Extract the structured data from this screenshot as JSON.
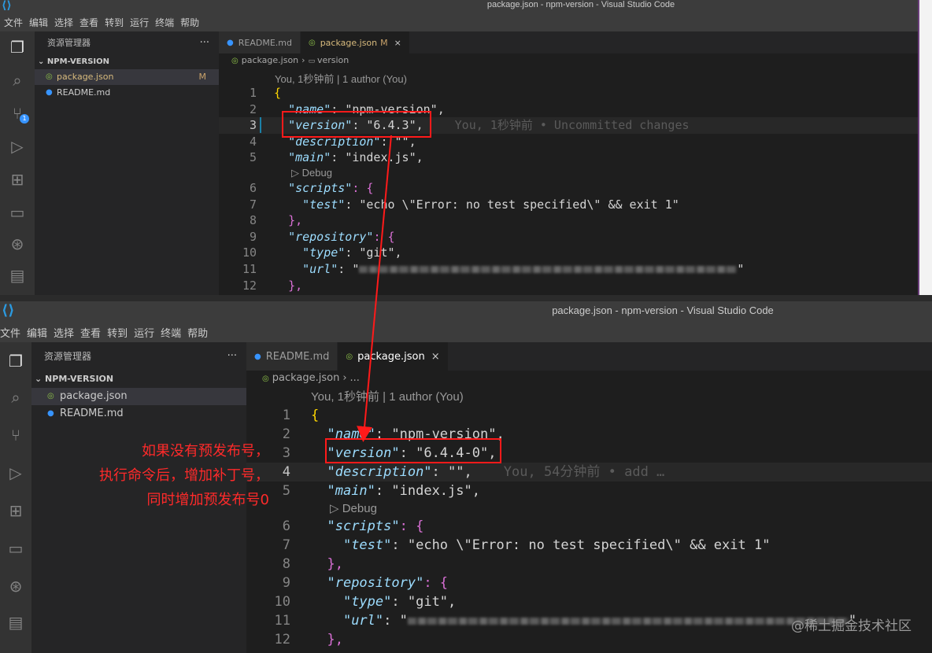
{
  "top": {
    "title": "package.json - npm-version - Visual Studio Code",
    "menu": [
      "文件",
      "编辑",
      "选择",
      "查看",
      "转到",
      "运行",
      "终端",
      "帮助"
    ],
    "sidebar": {
      "header": "资源管理器",
      "more": "···",
      "section": "NPM-VERSION",
      "files": [
        {
          "name": "package.json",
          "status": "M"
        },
        {
          "name": "README.md",
          "status": ""
        }
      ]
    },
    "tabs": [
      {
        "label": "README.md",
        "icon": "info-icon",
        "active": false
      },
      {
        "label": "package.json",
        "icon": "json-icon",
        "status": "M",
        "active": true
      }
    ],
    "breadcrumb": [
      "package.json",
      "version"
    ],
    "codelens": "You, 1秒钟前 | 1 author (You)",
    "debug": "Debug",
    "blame": "You, 1秒钟前 • Uncommitted changes",
    "scm_badge": "1",
    "lines": [
      {
        "n": "1",
        "text": "{"
      },
      {
        "n": "2",
        "key": "\"name\"",
        "value": "\"npm-version\"",
        "end": ","
      },
      {
        "n": "3",
        "key": "\"version\"",
        "value": "\"6.4.3\"",
        "end": ","
      },
      {
        "n": "4",
        "key": "\"description\"",
        "value": "\"\"",
        "end": ","
      },
      {
        "n": "5",
        "key": "\"main\"",
        "value": "\"index.js\"",
        "end": ","
      },
      {
        "n": "6",
        "key": "\"scripts\"",
        "end": ": {"
      },
      {
        "n": "7",
        "key": "\"test\"",
        "value": "\"echo \\\"Error: no test specified\\\" && exit 1\""
      },
      {
        "n": "8",
        "text": "},"
      },
      {
        "n": "9",
        "key": "\"repository\"",
        "end": ": {"
      },
      {
        "n": "10",
        "key": "\"type\"",
        "value": "\"git\"",
        "end": ","
      },
      {
        "n": "11",
        "key": "\"url\"",
        "value": "\""
      },
      {
        "n": "12",
        "text": "},"
      }
    ]
  },
  "bottom": {
    "title": "package.json - npm-version - Visual Studio Code",
    "menu": [
      "文件",
      "编辑",
      "选择",
      "查看",
      "转到",
      "运行",
      "终端",
      "帮助"
    ],
    "sidebar": {
      "header": "资源管理器",
      "more": "···",
      "section": "NPM-VERSION",
      "files": [
        {
          "name": "package.json",
          "status": ""
        },
        {
          "name": "README.md",
          "status": ""
        }
      ]
    },
    "tabs": [
      {
        "label": "README.md",
        "icon": "info-icon",
        "active": false
      },
      {
        "label": "package.json",
        "icon": "json-icon",
        "active": true,
        "close": "×"
      }
    ],
    "breadcrumb": [
      "package.json",
      "..."
    ],
    "codelens": "You, 1秒钟前 | 1 author (You)",
    "debug": "Debug",
    "blame": "You, 54分钟前 • add …",
    "lines": [
      {
        "n": "1",
        "text": "{"
      },
      {
        "n": "2",
        "key": "\"name\"",
        "value": "\"npm-version\"",
        "end": ","
      },
      {
        "n": "3",
        "key": "\"version\"",
        "value": "\"6.4.4-0\"",
        "end": ","
      },
      {
        "n": "4",
        "key": "\"description\"",
        "value": "\"\"",
        "end": ","
      },
      {
        "n": "5",
        "key": "\"main\"",
        "value": "\"index.js\"",
        "end": ","
      },
      {
        "n": "6",
        "key": "\"scripts\"",
        "end": ": {"
      },
      {
        "n": "7",
        "key": "\"test\"",
        "value": "\"echo \\\"Error: no test specified\\\" && exit 1\""
      },
      {
        "n": "8",
        "text": "},"
      },
      {
        "n": "9",
        "key": "\"repository\"",
        "end": ": {"
      },
      {
        "n": "10",
        "key": "\"type\"",
        "value": "\"git\"",
        "end": ","
      },
      {
        "n": "11",
        "key": "\"url\"",
        "value": "\""
      },
      {
        "n": "12",
        "text": "},"
      }
    ]
  },
  "annotation": [
    "如果没有预发布号，",
    "执行命令后，增加补丁号，",
    "同时增加预发布号0"
  ],
  "watermark": "@稀土掘金技术社区",
  "colors": {
    "annotation": "#ff2a2a",
    "accent": "#3794ff",
    "key": "#9cdcfe",
    "string": "#ce9178"
  }
}
